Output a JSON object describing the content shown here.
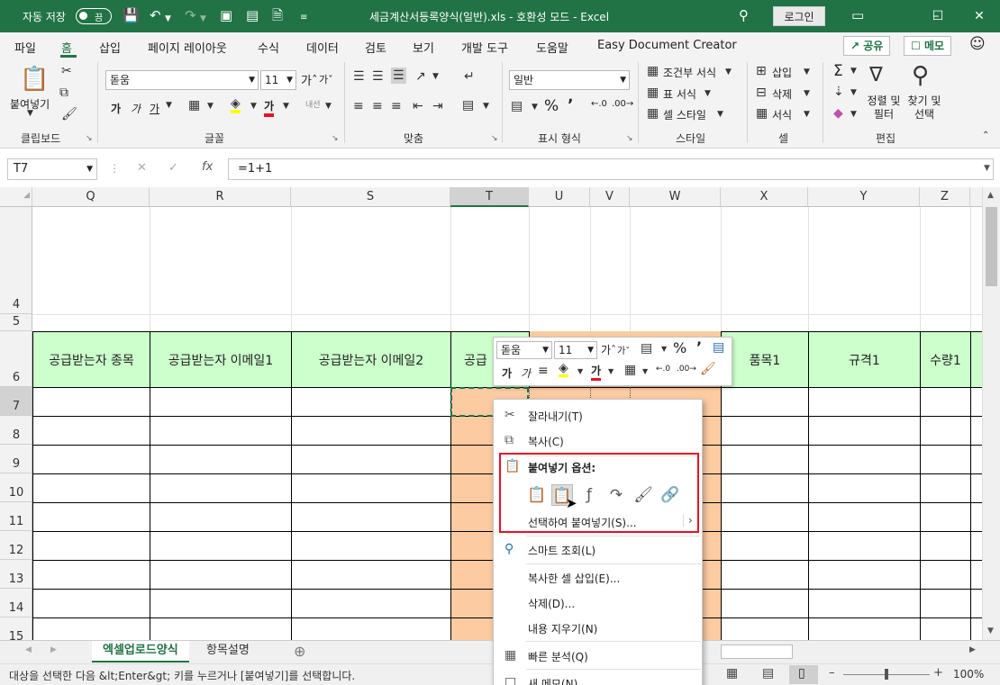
{
  "titlebar": {
    "autosave_label": "자동 저장",
    "autosave_state": "끔",
    "title": "세금계산서등록양식(일반).xls  -  호환성 모드  -  Excel",
    "login_label": "로그인"
  },
  "ribbon_tabs": [
    "파일",
    "홈",
    "삽입",
    "페이지 레이아웃",
    "수식",
    "데이터",
    "검토",
    "보기",
    "개발 도구",
    "도움말",
    "Easy Document Creator"
  ],
  "share": {
    "share_label": "공유",
    "memo_label": "메모"
  },
  "ribbon": {
    "clipboard": {
      "paste_label": "붙여넣기",
      "group_label": "클립보드"
    },
    "font": {
      "font_name": "돋움",
      "font_size": "11",
      "group_label": "글꼴",
      "bold": "가",
      "italic": "가",
      "underline": "가"
    },
    "align": {
      "group_label": "맞춤"
    },
    "number": {
      "format": "일반",
      "group_label": "표시 형식"
    },
    "styles": {
      "cond_format": "조건부 서식",
      "table_format": "표 서식",
      "cell_style": "셀 스타일",
      "group_label": "스타일"
    },
    "cells": {
      "insert": "삽입",
      "delete": "삭제",
      "format": "서식",
      "group_label": "셀"
    },
    "editing": {
      "sort_filter": "정렬 및 필터",
      "find_select": "찾기 및 선택",
      "group_label": "편집"
    }
  },
  "formula_bar": {
    "cell_ref": "T7",
    "formula": "=1+1"
  },
  "columns": [
    "Q",
    "R",
    "S",
    "T",
    "U",
    "V",
    "W",
    "X",
    "Y",
    "Z"
  ],
  "rows": [
    "4",
    "5",
    "6",
    "7",
    "8",
    "9",
    "10",
    "11",
    "12",
    "13",
    "14",
    "15"
  ],
  "headers": {
    "Q": "공급받는자 종목",
    "R": "공급받는자 이메일1",
    "S": "공급받는자 이메일2",
    "T": "공급",
    "X": "품목1",
    "Y": "규격1",
    "Z": "수량1"
  },
  "mini_toolbar": {
    "font_name": "돋움",
    "font_size": "11"
  },
  "context_menu": {
    "cut": "잘라내기(T)",
    "copy": "복사(C)",
    "paste_options": "붙여넣기 옵션:",
    "paste_special": "선택하여 붙여넣기(S)...",
    "smart_lookup": "스마트 조회(L)",
    "insert_copied": "복사한 셀 삽입(E)...",
    "delete": "삭제(D)...",
    "clear": "내용 지우기(N)",
    "quick_analysis": "빠른 분석(Q)",
    "new_note": "새 메모(N)"
  },
  "sheets": {
    "active": "엑셀업로드양식",
    "other": "항목설명"
  },
  "status": {
    "message": "대상을 선택한 다음 &lt;Enter&gt; 키를 누르거나 [붙여넣기]를 선택합니다.",
    "zoom": "100%"
  },
  "colors": {
    "excel_green": "#217346",
    "header_fill": "#ccffcc",
    "selection_fill": "#fccba1",
    "highlight_box": "#e81123"
  }
}
